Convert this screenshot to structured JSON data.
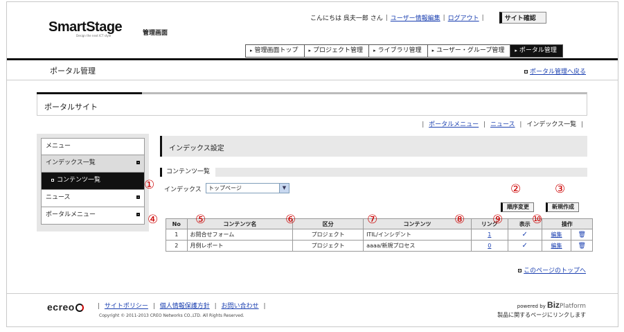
{
  "header": {
    "logo_main": "SmartStage",
    "logo_sub": "Design the next ICT style",
    "admin_label": "管理画面",
    "greeting": "こんにちは 呉夫一郎 さん",
    "user_info_link": "ユーザー情報編集",
    "logout_link": "ログアウト",
    "site_confirm": "サイト確認"
  },
  "nav": {
    "tabs": [
      {
        "label": "管理画面トップ"
      },
      {
        "label": "プロジェクト管理"
      },
      {
        "label": "ライブラリ管理"
      },
      {
        "label": "ユーザー・グループ管理"
      },
      {
        "label": "ポータル管理"
      }
    ]
  },
  "page": {
    "title": "ポータル管理",
    "back_link": "ポータル管理へ戻る",
    "portal_title": "ポータルサイト"
  },
  "subnav": {
    "portal_menu": "ポータルメニュー",
    "news": "ニュース",
    "index_list": "インデックス一覧"
  },
  "sidebar": {
    "items": [
      {
        "label": "メニュー"
      },
      {
        "label": "インデックス一覧"
      },
      {
        "label": "コンテンツ一覧"
      },
      {
        "label": "ニュース"
      },
      {
        "label": "ポータルメニュー"
      }
    ]
  },
  "main": {
    "section_title": "インデックス設定",
    "sub_title": "コンテンツ一覧",
    "index_label": "インデックス",
    "index_value": "トップページ",
    "order_button": "順序変更",
    "new_button": "新規作成",
    "markers": [
      "①",
      "②",
      "③",
      "④",
      "⑤",
      "⑥",
      "⑦",
      "⑧",
      "⑨",
      "⑩"
    ]
  },
  "table": {
    "headers": [
      "No",
      "コンテンツ名",
      "区分",
      "コンテンツ",
      "リンク",
      "表示",
      "操作"
    ],
    "rows": [
      {
        "no": "1",
        "name": "お問合せフォーム",
        "kind": "プロジェクト",
        "content": "ITIL/インシデント",
        "link": "1",
        "display": "✓",
        "edit": "編集"
      },
      {
        "no": "2",
        "name": "月例レポート",
        "kind": "プロジェクト",
        "content": "aaaa/新規プロセス",
        "link": "0",
        "display": "✓",
        "edit": "編集"
      }
    ]
  },
  "page_top_link": "このページのトップへ",
  "footer": {
    "logo": "ecreo",
    "links": [
      "サイトポリシー",
      "個人情報保護方針",
      "お問い合わせ"
    ],
    "copyright": "Copyright © 2011-2013 CREO Networks CO.,LTD. All Rights Reserved.",
    "powered_by": "powered by",
    "biz": "Biz",
    "platform": "Platform",
    "note": "製品に関するページにリンクします"
  }
}
